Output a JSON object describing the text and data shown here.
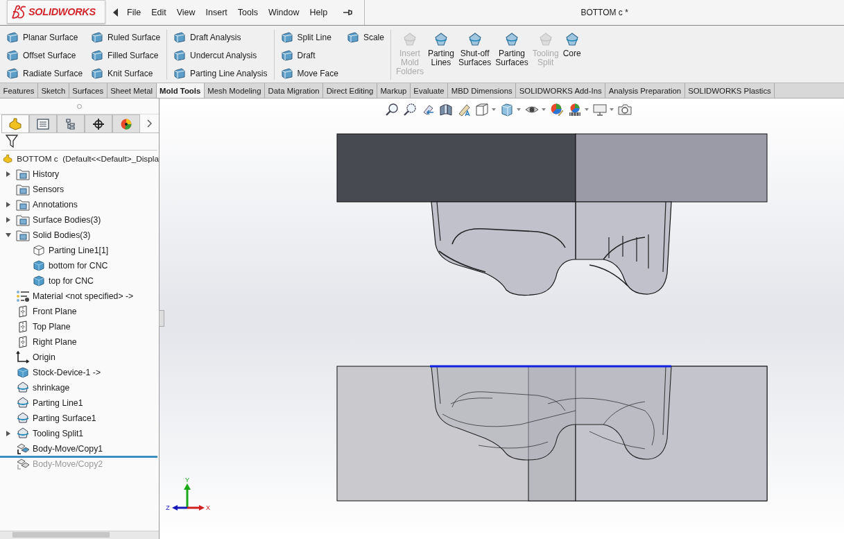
{
  "app": {
    "logo": "SOLIDWORKS"
  },
  "menu": [
    "File",
    "Edit",
    "View",
    "Insert",
    "Tools",
    "Window",
    "Help"
  ],
  "document_title": "BOTTOM c *",
  "ribbon": {
    "groups": [
      {
        "columns": [
          [
            "Planar Surface",
            "Offset Surface",
            "Radiate Surface"
          ],
          [
            "Ruled Surface",
            "Filled Surface",
            "Knit Surface"
          ]
        ]
      },
      {
        "columns": [
          [
            "Draft Analysis",
            "Undercut Analysis",
            "Parting Line Analysis"
          ]
        ]
      },
      {
        "columns": [
          [
            "Split Line",
            "Draft",
            "Move Face"
          ],
          [
            "Scale"
          ]
        ]
      }
    ],
    "large_buttons": [
      {
        "label": "Insert Mold Folders",
        "disabled": true
      },
      {
        "label": "Parting Lines",
        "disabled": false
      },
      {
        "label": "Shut-off Surfaces",
        "disabled": false
      },
      {
        "label": "Parting Surfaces",
        "disabled": false
      },
      {
        "label": "Tooling Split",
        "disabled": true
      },
      {
        "label": "Core",
        "disabled": false
      }
    ]
  },
  "tabs": [
    {
      "label": "Features",
      "selected": false
    },
    {
      "label": "Sketch",
      "selected": false
    },
    {
      "label": "Surfaces",
      "selected": false
    },
    {
      "label": "Sheet Metal",
      "selected": false
    },
    {
      "label": "Mold Tools",
      "selected": true
    },
    {
      "label": "Mesh Modeling",
      "selected": false
    },
    {
      "label": "Data Migration",
      "selected": false
    },
    {
      "label": "Direct Editing",
      "selected": false
    },
    {
      "label": "Markup",
      "selected": false
    },
    {
      "label": "Evaluate",
      "selected": false
    },
    {
      "label": "MBD Dimensions",
      "selected": false
    },
    {
      "label": "SOLIDWORKS Add-Ins",
      "selected": false
    },
    {
      "label": "Analysis Preparation",
      "selected": false
    },
    {
      "label": "SOLIDWORKS Plastics",
      "selected": false
    }
  ],
  "feature_tree": {
    "panel_tabs": [
      {
        "selected": true
      },
      {
        "selected": false
      },
      {
        "selected": false
      },
      {
        "selected": false
      },
      {
        "selected": false
      }
    ],
    "root": "BOTTOM c  (Default<<Default>_Displa",
    "items": [
      {
        "label": "History",
        "kind": "folder",
        "expanded": false,
        "rolled_back": false
      },
      {
        "label": "Sensors",
        "kind": "folder",
        "rolled_back": false
      },
      {
        "label": "Annotations",
        "kind": "folder",
        "expanded": false,
        "rolled_back": false
      },
      {
        "label": "Surface Bodies(3)",
        "kind": "folder",
        "expanded": false,
        "rolled_back": false
      },
      {
        "label": "Solid Bodies(3)",
        "kind": "folder",
        "expanded": true,
        "rolled_back": false,
        "children": [
          {
            "label": "Parting Line1[1]",
            "kind": "wire-body",
            "rolled_back": false
          },
          {
            "label": "bottom for CNC",
            "kind": "body",
            "rolled_back": false
          },
          {
            "label": "top for CNC",
            "kind": "body",
            "rolled_back": false
          }
        ]
      },
      {
        "label": "Material <not specified> ->",
        "kind": "material",
        "rolled_back": false
      },
      {
        "label": "Front Plane",
        "kind": "plane",
        "rolled_back": false
      },
      {
        "label": "Top Plane",
        "kind": "plane",
        "rolled_back": false
      },
      {
        "label": "Right Plane",
        "kind": "plane",
        "rolled_back": false
      },
      {
        "label": "Origin",
        "kind": "origin",
        "rolled_back": false
      },
      {
        "label": "Stock-Device-1 ->",
        "kind": "body",
        "rolled_back": false
      },
      {
        "label": "shrinkage",
        "kind": "feature",
        "rolled_back": false
      },
      {
        "label": "Parting Line1",
        "kind": "feature",
        "rolled_back": false
      },
      {
        "label": "Parting Surface1",
        "kind": "feature",
        "rolled_back": false
      },
      {
        "label": "Tooling Split1",
        "kind": "feature",
        "expanded": false,
        "rolled_back": false
      },
      {
        "label": "Body-Move/Copy1",
        "kind": "move",
        "rolled_back": false
      },
      {
        "label": "Body-Move/Copy2",
        "kind": "move",
        "rolled_back": true
      }
    ]
  },
  "triad": {
    "x": "X",
    "y": "Y",
    "z": "Z"
  }
}
